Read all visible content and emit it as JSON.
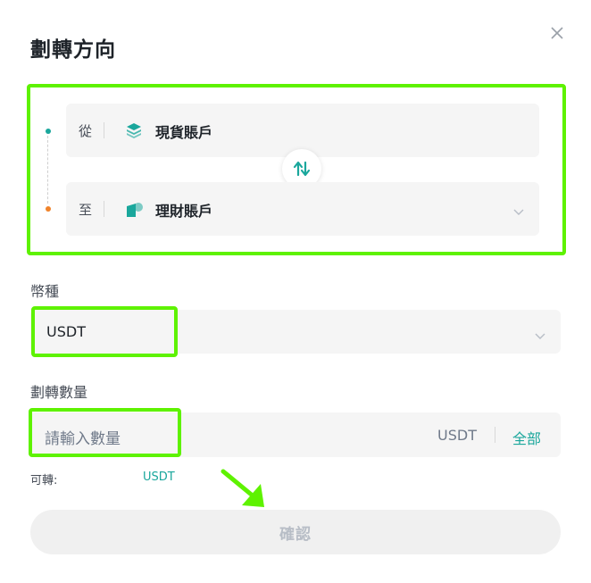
{
  "dialog": {
    "title": "劃轉方向"
  },
  "direction": {
    "from_label": "從",
    "from_account": "現貨賬戶",
    "to_label": "至",
    "to_account": "理財賬戶"
  },
  "coin": {
    "label": "幣種",
    "selected": "USDT"
  },
  "amount": {
    "label": "劃轉數量",
    "placeholder": "請輸入數量",
    "unit": "USDT",
    "all_button": "全部"
  },
  "available": {
    "label": "可轉:",
    "unit": "USDT"
  },
  "confirm_button": "確認",
  "colors": {
    "accent": "#1aa79c",
    "highlight": "#5ef200",
    "from_dot": "#1aa79c",
    "to_dot": "#f0832a"
  }
}
